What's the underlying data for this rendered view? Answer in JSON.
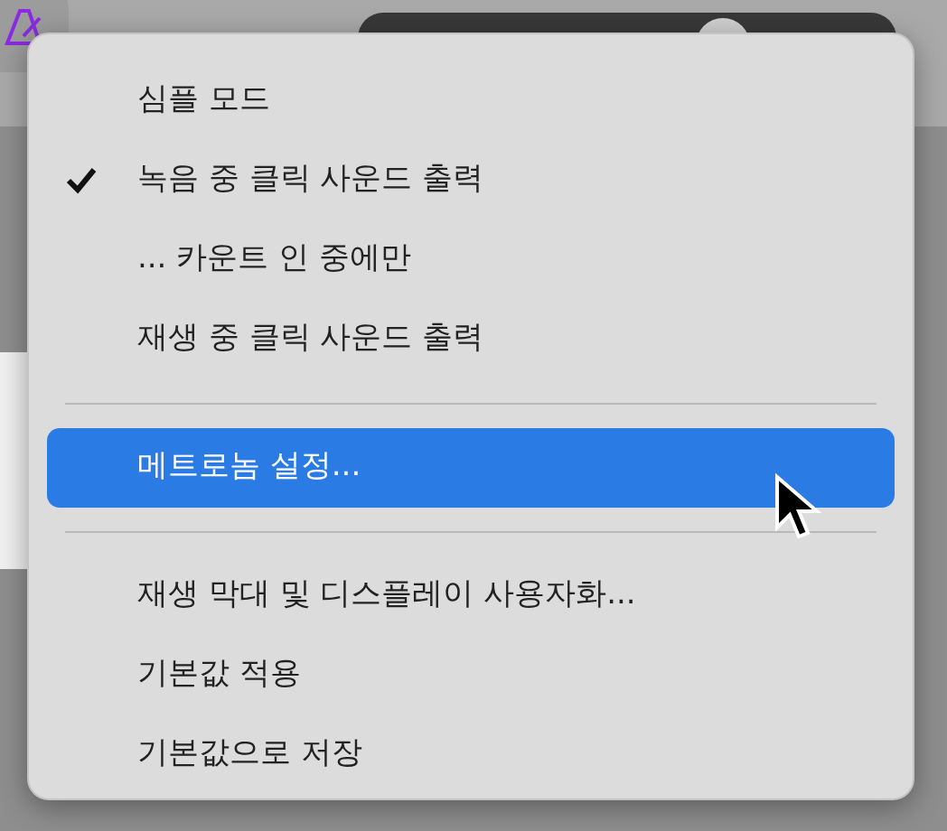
{
  "menu": {
    "items": [
      {
        "kind": "item",
        "label": "심플 모드",
        "checked": false,
        "selected": false
      },
      {
        "kind": "item",
        "label": "녹음 중 클릭 사운드 출력",
        "checked": true,
        "selected": false
      },
      {
        "kind": "item",
        "label": "... 카운트 인 중에만",
        "checked": false,
        "selected": false
      },
      {
        "kind": "item",
        "label": "재생 중 클릭 사운드 출력",
        "checked": false,
        "selected": false
      },
      {
        "kind": "separator"
      },
      {
        "kind": "item",
        "label": "메트로놈 설정...",
        "checked": false,
        "selected": true
      },
      {
        "kind": "separator"
      },
      {
        "kind": "item",
        "label": "재생 막대 및 디스플레이 사용자화...",
        "checked": false,
        "selected": false
      },
      {
        "kind": "item",
        "label": "기본값 적용",
        "checked": false,
        "selected": false
      },
      {
        "kind": "item",
        "label": "기본값으로 저장",
        "checked": false,
        "selected": false
      }
    ]
  }
}
